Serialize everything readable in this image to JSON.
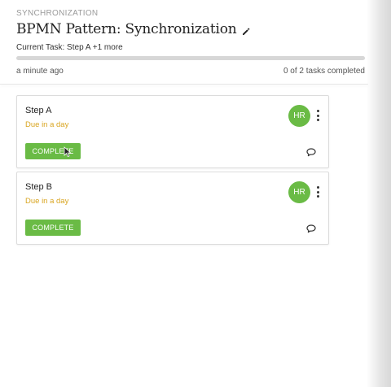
{
  "header": {
    "section": "SYNCHRONIZATION",
    "title": "BPMN Pattern: Synchronization",
    "current_task": "Current Task: Step A +1 more",
    "updated": "a minute ago",
    "progress_text": "0 of 2 tasks completed",
    "progress_fraction": 0
  },
  "tasks": [
    {
      "title": "Step A",
      "due": "Due in a day",
      "assignee_initials": "HR",
      "action_label": "COMPLETE"
    },
    {
      "title": "Step B",
      "due": "Due in a day",
      "assignee_initials": "HR",
      "action_label": "COMPLETE"
    }
  ],
  "icons": {
    "edit": "pencil-icon",
    "menu": "kebab-menu-icon",
    "comments": "comment-icon",
    "pointer": "mouse-cursor-icon"
  },
  "colors": {
    "accent": "#6abb45",
    "due": "#d9a520",
    "progress_track": "#d7d7d7"
  }
}
